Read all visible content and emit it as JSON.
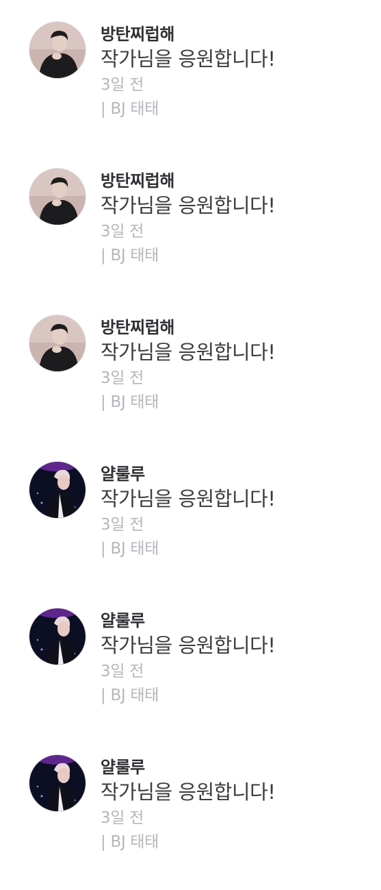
{
  "comments": [
    {
      "author": "방탄찌럽해",
      "avatar_icon": "user-avatar-dark-suit-icon",
      "message": "작가님을 응원합니다!",
      "time": "3일 전",
      "source": "| BJ 태태"
    },
    {
      "author": "방탄찌럽해",
      "avatar_icon": "user-avatar-dark-suit-icon",
      "message": "작가님을 응원합니다!",
      "time": "3일 전",
      "source": "| BJ 태태"
    },
    {
      "author": "방탄찌럽해",
      "avatar_icon": "user-avatar-dark-suit-icon",
      "message": "작가님을 응원합니다!",
      "time": "3일 전",
      "source": "| BJ 태태"
    },
    {
      "author": "얄룰루",
      "avatar_icon": "user-avatar-stage-performer-icon",
      "message": "작가님을 응원합니다!",
      "time": "3일 전",
      "source": "| BJ 태태"
    },
    {
      "author": "얄룰루",
      "avatar_icon": "user-avatar-stage-performer-icon",
      "message": "작가님을 응원합니다!",
      "time": "3일 전",
      "source": "| BJ 태태"
    },
    {
      "author": "얄룰루",
      "avatar_icon": "user-avatar-stage-performer-icon",
      "message": "작가님을 응원합니다!",
      "time": "3일 전",
      "source": "| BJ 태태"
    }
  ],
  "colors": {
    "author": "#2f2f33",
    "message": "#3c3c40",
    "meta": "#b4b6bb"
  }
}
